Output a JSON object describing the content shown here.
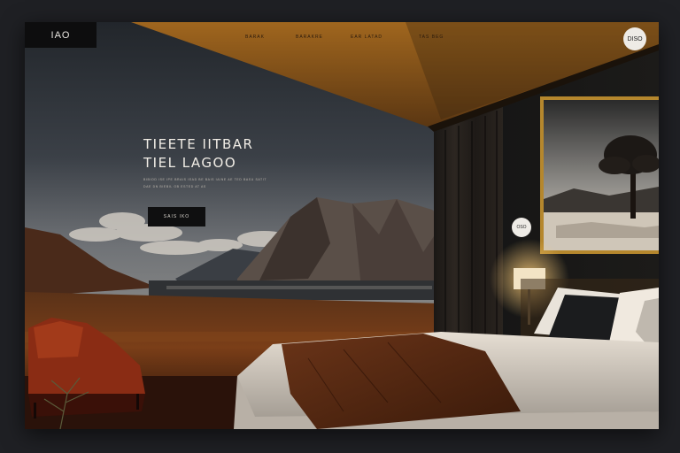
{
  "logo": {
    "text": "IAO"
  },
  "nav": {
    "items": [
      {
        "label": "BARAK"
      },
      {
        "label": "BARAKRE"
      },
      {
        "label": "EAR LATAD"
      },
      {
        "label": "TAS BEG"
      }
    ]
  },
  "corner_badge": {
    "text": "DISO"
  },
  "hero": {
    "title_line1": "TIEETE IITBAR",
    "title_line2": "TIEL LAGOO",
    "subtitle": "BIBIOD ISE IPE BRAIS IEAD BE BAIS IAINE AE TED BASU SATIT DAE DN BIEBIL OB ESTED AT AS",
    "cta_label": "SAIS IKO"
  },
  "info_pin": {
    "text": "OSO"
  }
}
